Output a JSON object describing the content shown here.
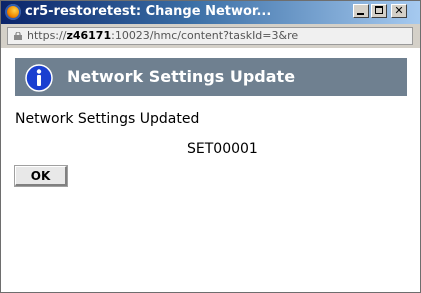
{
  "window": {
    "title": "cr5-restoretest: Change Networ...",
    "app_icon": "browser-icon",
    "buttons": {
      "minimize": "minimize-icon",
      "maximize": "maximize-icon",
      "close_label": "✕"
    }
  },
  "address_bar": {
    "url_prefix": "https://",
    "url_host": "z46171",
    "url_rest": ":10023/hmc/content?taskId=3&re",
    "lock_icon": "lock-icon"
  },
  "dialog": {
    "icon": "info-icon",
    "icon_glyph": "i",
    "title": "Network Settings Update",
    "message": "Network Settings Updated",
    "code": "SET00001",
    "ok_label": "OK"
  },
  "colors": {
    "header_bar": "#6f8090",
    "info_icon_fill": "#1a3fd0"
  }
}
